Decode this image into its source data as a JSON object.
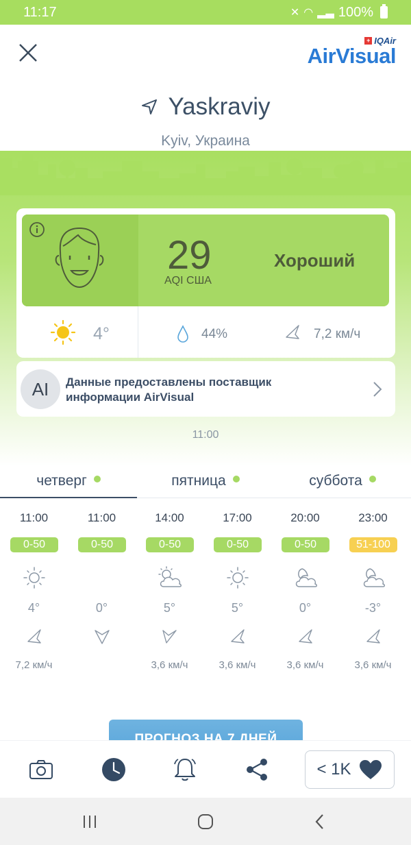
{
  "status_bar": {
    "time": "11:17",
    "battery": "100%"
  },
  "header": {
    "logo_brand": "IQAir",
    "logo_name": "AirVisual",
    "location_name": "Yaskraviy",
    "location_sub": "Kyiv, Украина"
  },
  "aqi": {
    "value": "29",
    "label": "AQI США",
    "level": "Хороший",
    "color": "#a6d964"
  },
  "current_weather": {
    "temperature": "4°",
    "humidity": "44%",
    "wind": "7,2 км/ч"
  },
  "provider": {
    "avatar": "AI",
    "text_prefix": "Данные предоставлены ",
    "text_bold": "поставщик информации AirVisual"
  },
  "update_time": "11:00",
  "tabs": [
    {
      "label": "четверг"
    },
    {
      "label": "пятница"
    },
    {
      "label": "суббота"
    }
  ],
  "hourly": [
    {
      "time": "11:00",
      "aqi": "0-50",
      "icon": "sun-icon",
      "temp": "4°",
      "wind": "7,2 км/ч"
    },
    {
      "time": "11:00",
      "aqi": "0-50",
      "icon": "none",
      "temp": "0°",
      "wind": ""
    },
    {
      "time": "14:00",
      "aqi": "0-50",
      "icon": "partly-cloudy-icon",
      "temp": "5°",
      "wind": "3,6 км/ч"
    },
    {
      "time": "17:00",
      "aqi": "0-50",
      "icon": "sun-icon",
      "temp": "5°",
      "wind": "3,6 км/ч"
    },
    {
      "time": "20:00",
      "aqi": "0-50",
      "icon": "cloudy-night-icon",
      "temp": "0°",
      "wind": "3,6 км/ч"
    },
    {
      "time": "23:00",
      "aqi": "51-100",
      "icon": "cloudy-night-icon",
      "temp": "-3°",
      "wind": "3,6 км/ч"
    }
  ],
  "forecast_button": "ПРОГНОЗ НА 7 ДНЕЙ",
  "toolbar": {
    "likes": "< 1K"
  },
  "colors": {
    "good": "#a6d964",
    "moderate": "#f7d052",
    "brand": "#2a7bd5",
    "accent_dark": "#344a64"
  }
}
